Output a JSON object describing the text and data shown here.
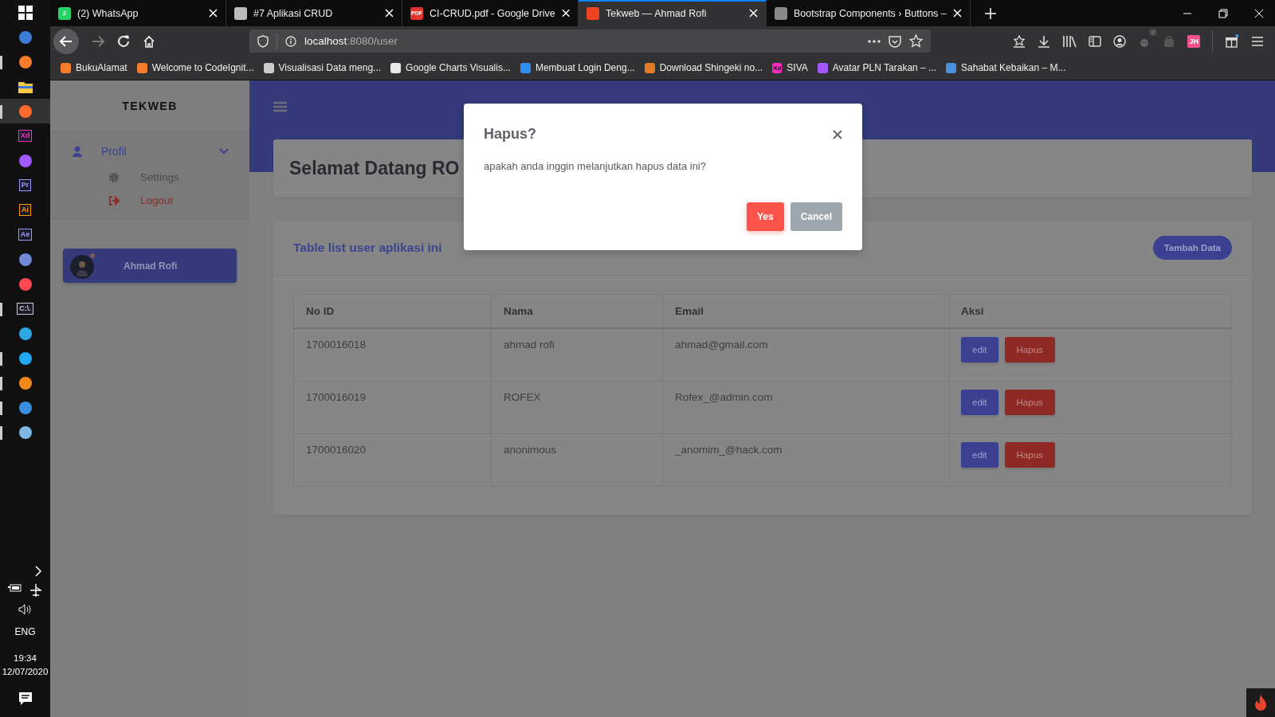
{
  "taskbar": {
    "apps": [
      {
        "kind": "windows",
        "running": false,
        "active": false
      },
      {
        "kind": "app",
        "color": "#3d7bd9",
        "running": false,
        "active": false
      },
      {
        "kind": "app",
        "color": "#f57c2a",
        "running": true,
        "active": false
      },
      {
        "kind": "folder",
        "running": false,
        "active": false
      },
      {
        "kind": "app",
        "color": "#ff6a2b",
        "running": true,
        "active": true
      },
      {
        "kind": "letters",
        "label": "Xd",
        "color": "#ff2bc2",
        "running": false,
        "active": false
      },
      {
        "kind": "app",
        "color": "#a259ff",
        "running": false,
        "active": false
      },
      {
        "kind": "letters",
        "label": "Pr",
        "color": "#9999ff",
        "running": false,
        "active": false
      },
      {
        "kind": "letters",
        "label": "Ai",
        "color": "#ff9a00",
        "running": false,
        "active": false
      },
      {
        "kind": "letters",
        "label": "Ae",
        "color": "#9999fe",
        "running": false,
        "active": false
      },
      {
        "kind": "app",
        "color": "#7289da",
        "running": false,
        "active": false
      },
      {
        "kind": "app",
        "color": "#ff4655",
        "running": false,
        "active": false
      },
      {
        "kind": "letters",
        "label": "C:\\.",
        "color": "#cccccc",
        "running": true,
        "active": false
      },
      {
        "kind": "app",
        "color": "#2ea8e5",
        "running": false,
        "active": false
      },
      {
        "kind": "app",
        "color": "#23a9f2",
        "running": true,
        "active": false
      },
      {
        "kind": "app",
        "color": "#f28a1a",
        "running": true,
        "active": false
      },
      {
        "kind": "app",
        "color": "#3a8de0",
        "running": true,
        "active": false
      },
      {
        "kind": "app",
        "color": "#7fb8e6",
        "running": true,
        "active": false
      }
    ],
    "language": "ENG",
    "time": "19:34",
    "date": "12/07/2020"
  },
  "browser": {
    "tabs": [
      {
        "title": "(2) WhatsApp",
        "icon_text": "2",
        "color": "#25d366",
        "selected": false
      },
      {
        "title": "#7 Aplikasi CRUD",
        "color": "#bbbbbb",
        "selected": false
      },
      {
        "title": "CI-CRUD.pdf - Google Drive",
        "icon_text": "PDF",
        "color": "#e5322d",
        "selected": false
      },
      {
        "title": "Tekweb — Ahmad Rofi",
        "color": "#ee4323",
        "selected": true
      },
      {
        "title": "Bootstrap Components › Buttons –",
        "color": "#888888",
        "selected": false
      }
    ],
    "address": {
      "host": "localhost",
      "path": ":8080/user"
    },
    "extension_count": "0",
    "profile_initials": "JH",
    "bookmarks": [
      {
        "label": "BukuAlamat",
        "color": "#f57c2a"
      },
      {
        "label": "Welcome to CodeIgnit...",
        "color": "#f57c2b"
      },
      {
        "label": "Visualisasi Data meng...",
        "color": "#cccccc"
      },
      {
        "label": "Google Charts Visualis...",
        "color": "#e8e8e8"
      },
      {
        "label": "Membuat Login Deng...",
        "color": "#2f8ff0"
      },
      {
        "label": "Download Shingeki no...",
        "color": "#e07b28"
      },
      {
        "label": "SIVA",
        "icon_text": "Xd",
        "color": "#ff2bc2"
      },
      {
        "label": "Avatar PLN Tarakan – ...",
        "color": "#a259ff"
      },
      {
        "label": "Sahabat Kebaikan – M...",
        "color": "#4a8fe0"
      }
    ]
  },
  "sidebar": {
    "brand": "TEKWEB",
    "menu": [
      {
        "label": "Profil",
        "expanded": true,
        "children": [
          {
            "label": "Settings",
            "kind": "settings"
          },
          {
            "label": "Logout",
            "kind": "logout"
          }
        ]
      }
    ],
    "user": {
      "name": "Ahmad Rofi"
    }
  },
  "main": {
    "heading": "Selamat Datang RO",
    "table_title": "Table list user aplikasi ini",
    "add_button": "Tambah Data",
    "columns": [
      "No ID",
      "Nama",
      "Email",
      "Aksi"
    ],
    "rows": [
      {
        "id": "1700016018",
        "name": "ahmad rofi",
        "email": "ahmad@gmail.com",
        "actions": [
          "edit",
          "Hapus"
        ]
      },
      {
        "id": "1700016019",
        "name": "ROFEX",
        "email": "Rofex_@admin.com",
        "actions": [
          "edit",
          "Hapus"
        ]
      },
      {
        "id": "1700016020",
        "name": "anonimous",
        "email": "_anomim_@hack.com",
        "actions": [
          "edit",
          "Hapus"
        ]
      }
    ]
  },
  "modal": {
    "title": "Hapus?",
    "message": "apakah anda inggin melanjutkan hapus data ini?",
    "buttons": [
      {
        "label": "Yes",
        "kind": "confirm"
      },
      {
        "label": "Cancel",
        "kind": "cancel"
      }
    ]
  }
}
